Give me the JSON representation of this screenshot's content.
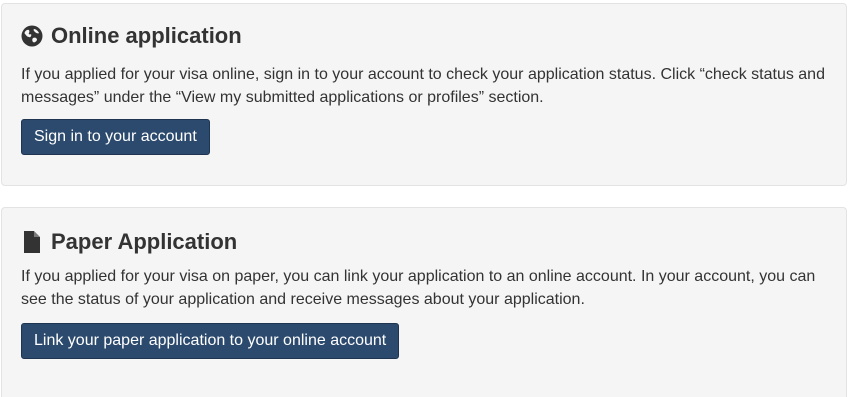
{
  "online": {
    "icon": "globe-icon",
    "title": "Online application",
    "description": "If you applied for your visa online, sign in to your account to check your application status. Click “check status and messages” under the “View my submitted applications or profiles” section.",
    "button_label": "Sign in to your account"
  },
  "paper": {
    "icon": "file-icon",
    "title": "Paper Application",
    "description": "If you applied for your visa on paper, you can link your application to an online account. In your account, you can see the status of your application and receive messages about your application.",
    "button_label": "Link your paper application to your online account"
  },
  "colors": {
    "card_background": "#f5f5f5",
    "button_background": "#2c4a6e",
    "text": "#333333"
  }
}
